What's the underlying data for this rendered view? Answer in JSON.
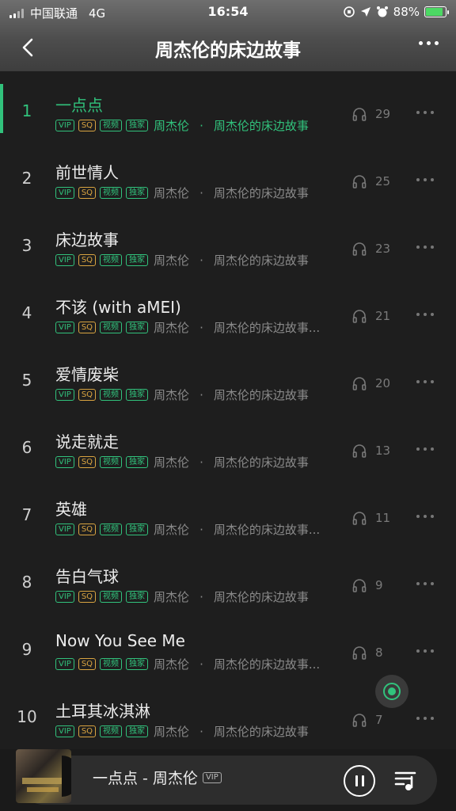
{
  "status_bar": {
    "carrier": "中国联通",
    "network": "4G",
    "time": "16:54",
    "battery": "88%",
    "battery_level": 0.88
  },
  "header": {
    "title": "周杰伦的床边故事"
  },
  "tags": {
    "vip": "VIP",
    "sq": "SQ",
    "video": "视频",
    "exclusive": "独家"
  },
  "separator": "·",
  "songs": [
    {
      "index": "1",
      "title": "一点点",
      "artist": "周杰伦",
      "album": "周杰伦的床边故事",
      "count": "29"
    },
    {
      "index": "2",
      "title": "前世情人",
      "artist": "周杰伦",
      "album": "周杰伦的床边故事",
      "count": "25"
    },
    {
      "index": "3",
      "title": "床边故事",
      "artist": "周杰伦",
      "album": "周杰伦的床边故事",
      "count": "23"
    },
    {
      "index": "4",
      "title": "不该 (with aMEI)",
      "artist": "周杰伦",
      "album": "周杰伦的床边故事...",
      "count": "21"
    },
    {
      "index": "5",
      "title": "爱情废柴",
      "artist": "周杰伦",
      "album": "周杰伦的床边故事",
      "count": "20"
    },
    {
      "index": "6",
      "title": "说走就走",
      "artist": "周杰伦",
      "album": "周杰伦的床边故事",
      "count": "13"
    },
    {
      "index": "7",
      "title": "英雄",
      "artist": "周杰伦",
      "album": "周杰伦的床边故事...",
      "count": "11"
    },
    {
      "index": "8",
      "title": "告白气球",
      "artist": "周杰伦",
      "album": "周杰伦的床边故事",
      "count": "9"
    },
    {
      "index": "9",
      "title": "Now You See Me",
      "artist": "周杰伦",
      "album": "周杰伦的床边故事...",
      "count": "8"
    },
    {
      "index": "10",
      "title": "土耳其冰淇淋",
      "artist": "周杰伦",
      "album": "周杰伦的床边故事",
      "count": "7"
    }
  ],
  "now_playing": {
    "text": "一点点 - 周杰伦",
    "vip": "VIP"
  },
  "colors": {
    "accent": "#31c27c",
    "background": "#1e1e1e",
    "sq_gold": "#d9a441"
  }
}
